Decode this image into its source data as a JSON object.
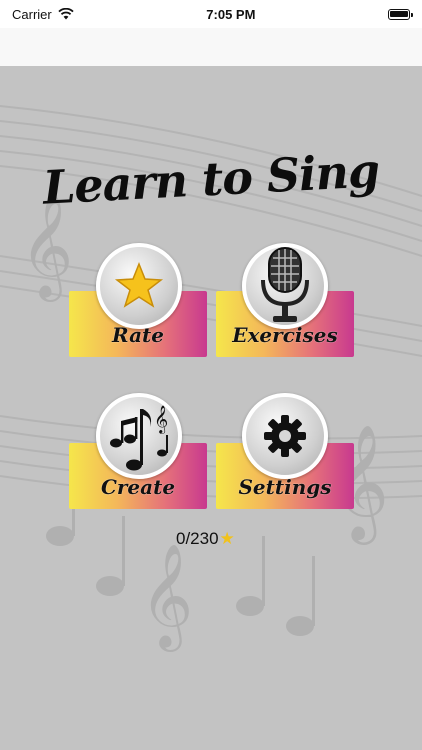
{
  "status_bar": {
    "carrier": "Carrier",
    "time": "7:05 PM"
  },
  "app_title": "Learn to Sing",
  "menu": {
    "rate": {
      "label": "Rate",
      "icon": "star-icon"
    },
    "exercises": {
      "label": "Exercises",
      "icon": "microphone-icon"
    },
    "create": {
      "label": "Create",
      "icon": "music-notes-icon"
    },
    "settings": {
      "label": "Settings",
      "icon": "gear-icon"
    }
  },
  "score": {
    "text": "0/230",
    "icon": "star-icon"
  },
  "colors": {
    "tile_start": "#f5e64b",
    "tile_end": "#c8398f",
    "background": "#c3c3c3"
  }
}
